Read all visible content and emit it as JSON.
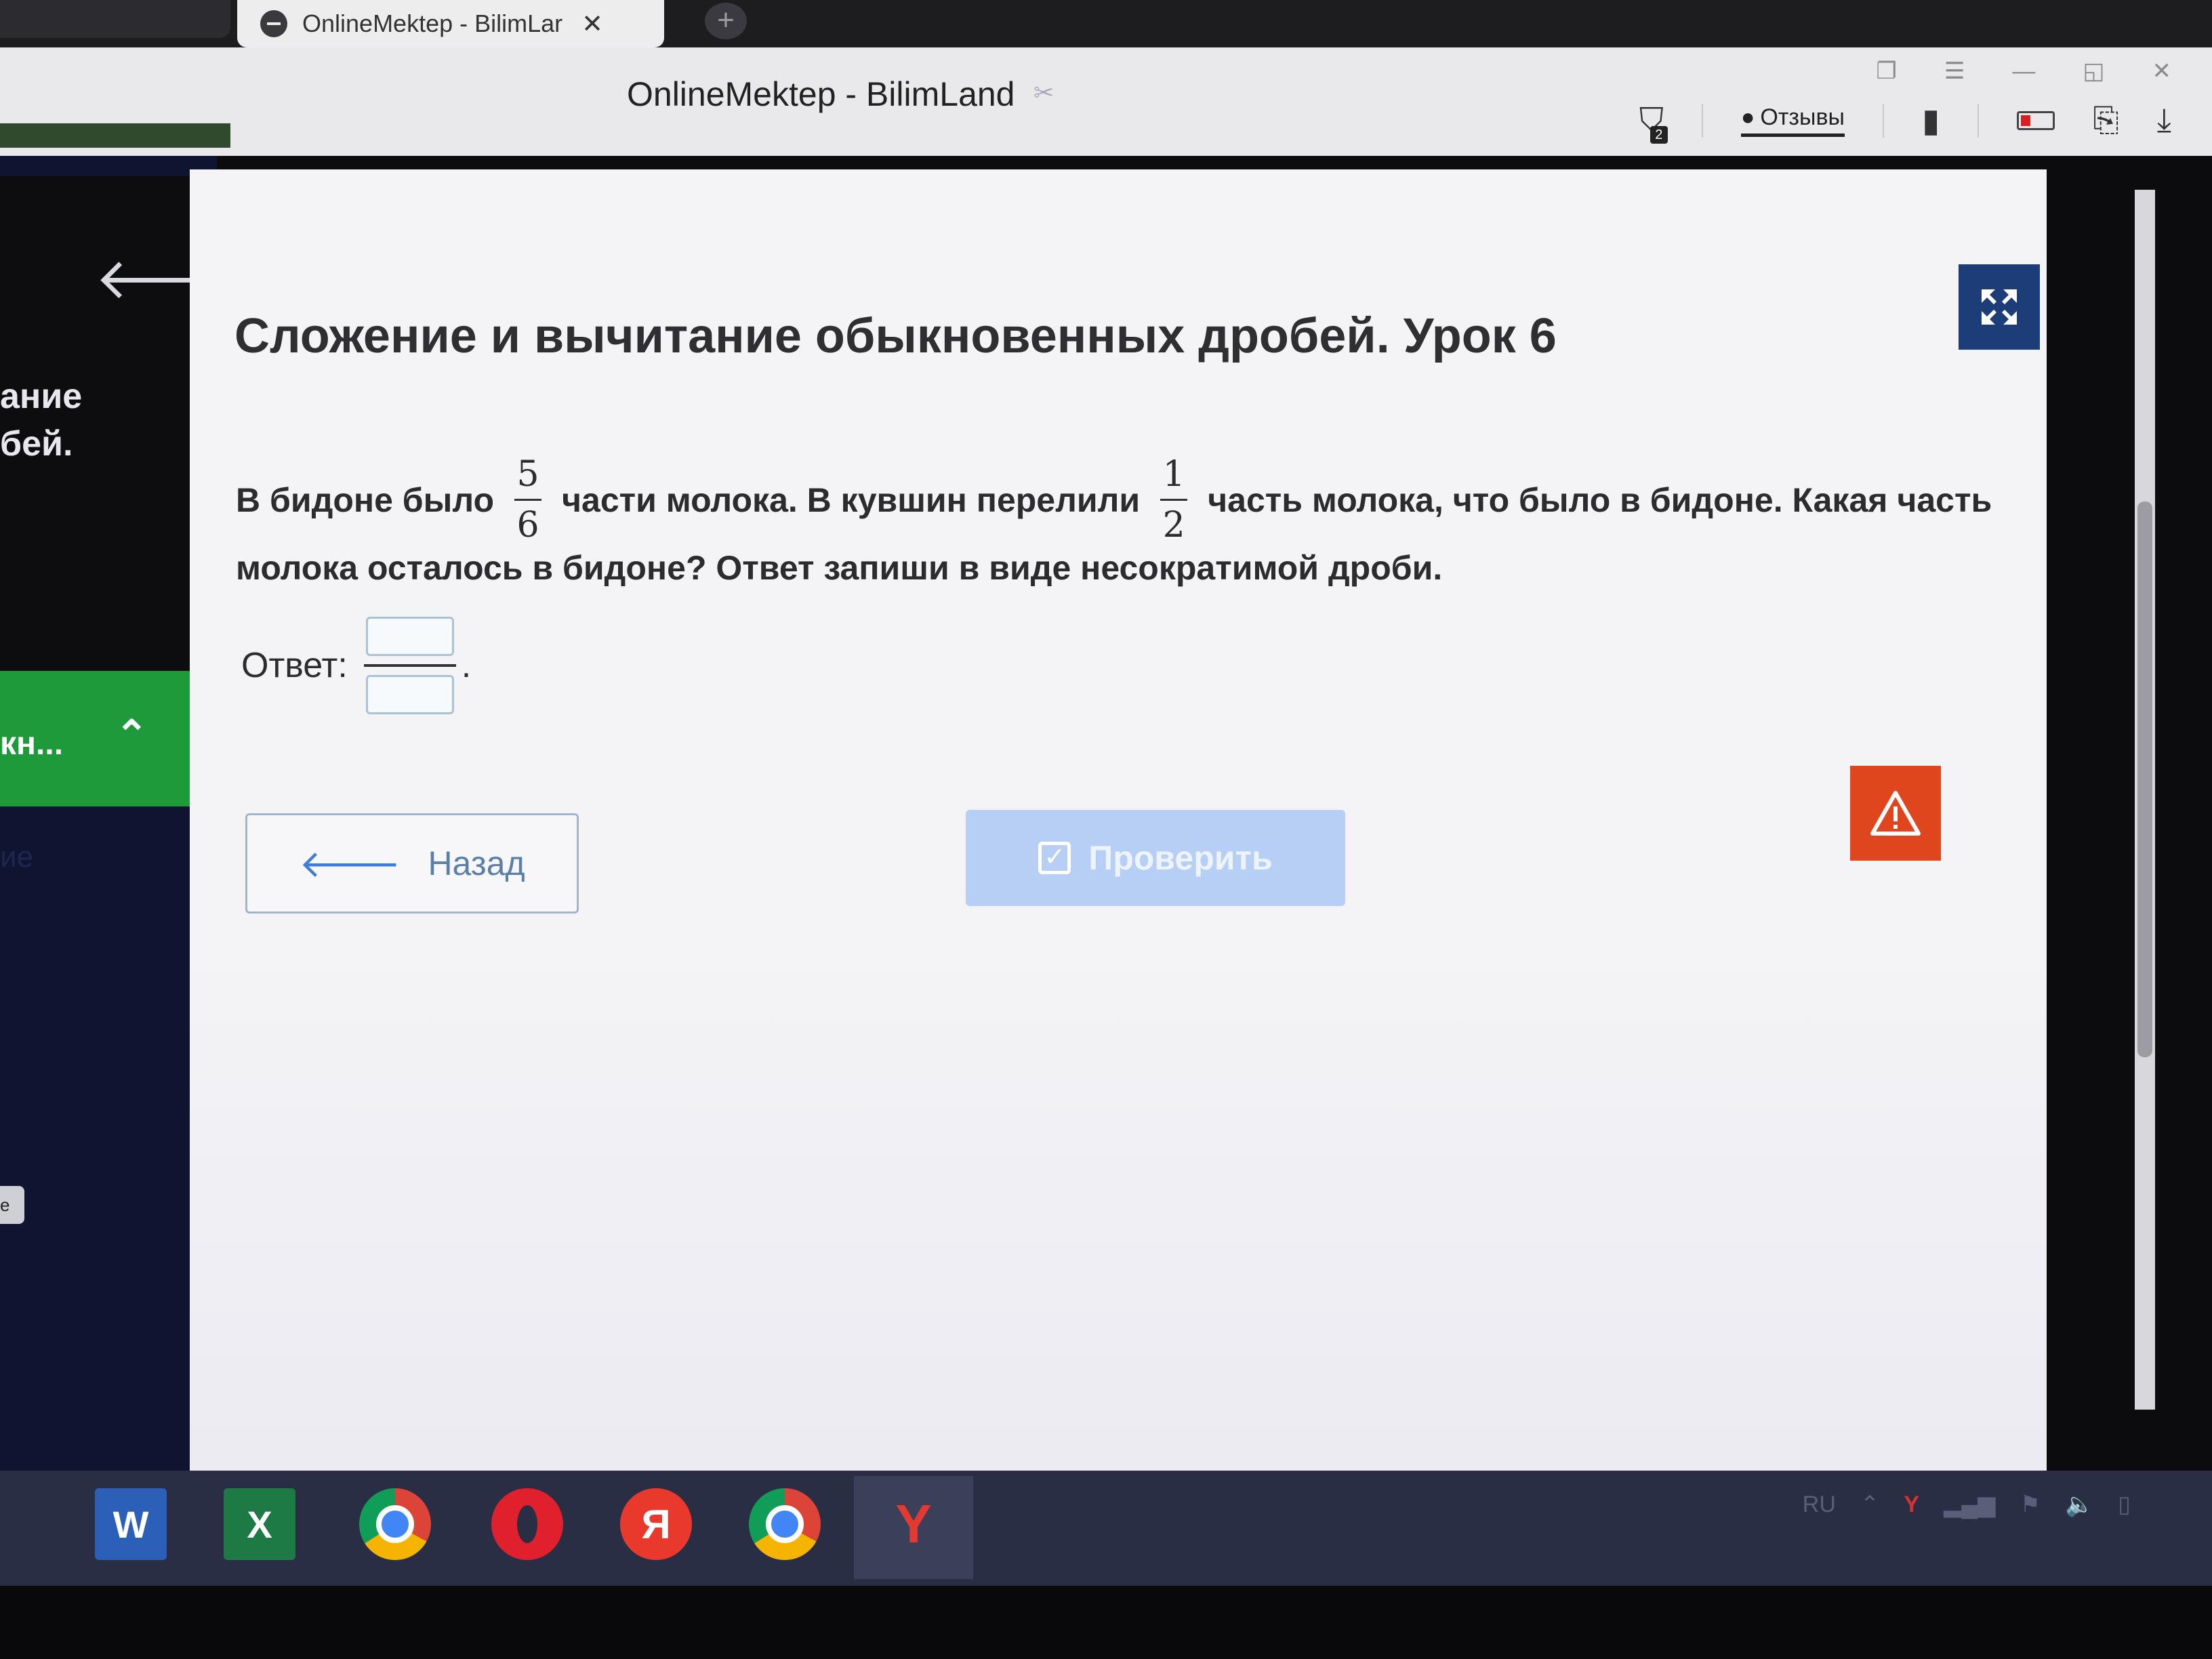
{
  "browser": {
    "tab_title": "OnlineMektep - BilimLar",
    "tab_close": "✕",
    "new_tab": "+",
    "window_title": "OnlineMektep - BilimLand",
    "tabs_badge": "2",
    "reviews_label": "Отзывы",
    "window_controls": [
      "❐",
      "☰",
      "—",
      "◱",
      "✕"
    ]
  },
  "sidebar": {
    "back_arrow": "🡐",
    "lesson_title_fragment": "ание\nбей.",
    "section_label": "кн...",
    "faint_label": "ие",
    "pill_label": "е"
  },
  "lesson": {
    "title": "Сложение и вычитание обыкновенных дробей. Урок 6"
  },
  "question": {
    "part1": "В бидоне было",
    "frac1": {
      "num": "5",
      "den": "6"
    },
    "part2": "части молока. В кувшин перелили",
    "frac2": {
      "num": "1",
      "den": "2"
    },
    "part3": "часть молока, что было в бидоне. Какая часть",
    "line2": "молока осталось в бидоне? Ответ запиши в виде несократимой дроби."
  },
  "answer": {
    "label": "Ответ:",
    "numerator_value": "",
    "denominator_value": "",
    "trailing": "."
  },
  "buttons": {
    "back_label": "Назад",
    "check_label": "Проверить"
  },
  "taskbar": {
    "apps": [
      "word",
      "excel",
      "chrome",
      "opera",
      "yandex",
      "chrome",
      "yandex-browser"
    ],
    "word_letter": "W",
    "excel_letter": "X",
    "yandex_letter": "Я",
    "ybrowser_letter": "Y",
    "tray_lang": "RU",
    "tray_y": "Y"
  },
  "colors": {
    "sidebar_green": "#1f9a3a",
    "fullscreen_blue": "#1c3d78",
    "check_button": "#b7cff4",
    "warning_orange": "#e0461d"
  }
}
